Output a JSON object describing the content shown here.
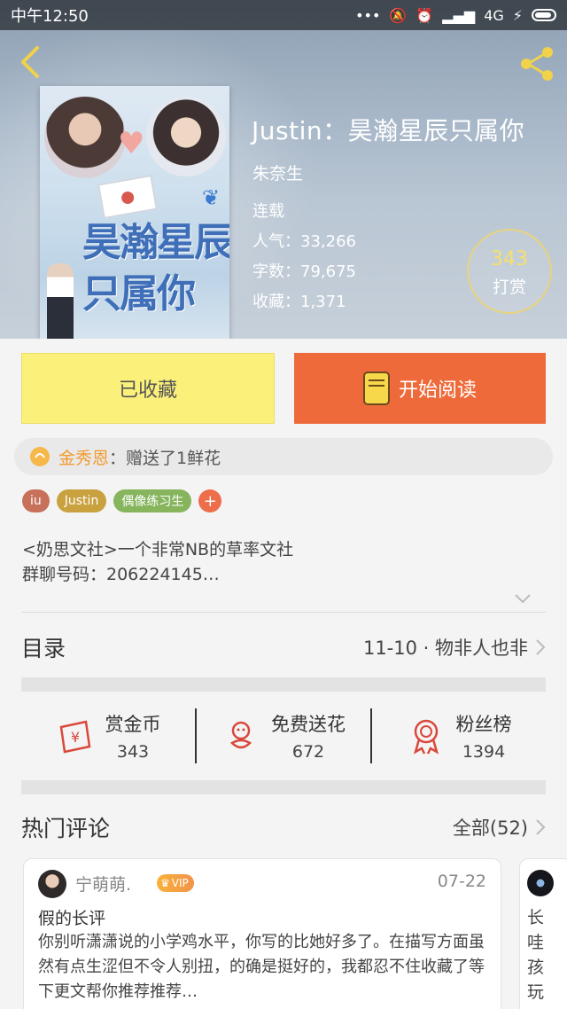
{
  "status_bar": {
    "time": "中午12:50",
    "network": "4G"
  },
  "book": {
    "cover_title": "昊瀚星辰只属你",
    "title": "Justin：昊瀚星辰只属你",
    "author": "朱奈生",
    "status": "连载",
    "popularity": "人气：33,266",
    "word_count": "字数：79,675",
    "favorites": "收藏：1,371",
    "tip_count": "343",
    "tip_label": "打赏"
  },
  "actions": {
    "favorited_label": "已收藏",
    "read_label": "开始阅读"
  },
  "gift": {
    "user": "金秀恩",
    "text": "：赠送了1鲜花"
  },
  "tags": [
    {
      "label": "iu",
      "color": "#c8715a"
    },
    {
      "label": "Justin",
      "color": "#c9a13e"
    },
    {
      "label": "偶像练习生",
      "color": "#86b55d"
    },
    {
      "label": "+",
      "color": "#ee6d4b"
    }
  ],
  "description": {
    "line1": "<奶思文社>一个非常NB的草率文社",
    "line2": "群聊号码：206224145…"
  },
  "toc": {
    "title": "目录",
    "latest": "11-10 · 物非人也非"
  },
  "stats": [
    {
      "label": "赏金币",
      "value": "343",
      "icon": "reward-coin-icon"
    },
    {
      "label": "免费送花",
      "value": "672",
      "icon": "flower-icon"
    },
    {
      "label": "粉丝榜",
      "value": "1394",
      "icon": "ribbon-medal-icon"
    }
  ],
  "comments": {
    "title": "热门评论",
    "all_label": "全部(52)",
    "items": [
      {
        "user": "宁萌萌.",
        "badge": "VIP",
        "date": "07-22",
        "title": "假的长评",
        "body": "你别听潇潇说的小学鸡水平，你写的比她好多了。在描写方面虽然有点生涩但不令人别扭，的确是挺好的，我都忍不住收藏了等下更文帮你推荐推荐…"
      },
      {
        "peek": "长 哇 孩 玩"
      }
    ]
  },
  "colors": {
    "accent_orange": "#ef6a3a",
    "fav_yellow": "#faf07a",
    "gift_orange": "#f29a2e",
    "icon_red": "#d9483b"
  }
}
